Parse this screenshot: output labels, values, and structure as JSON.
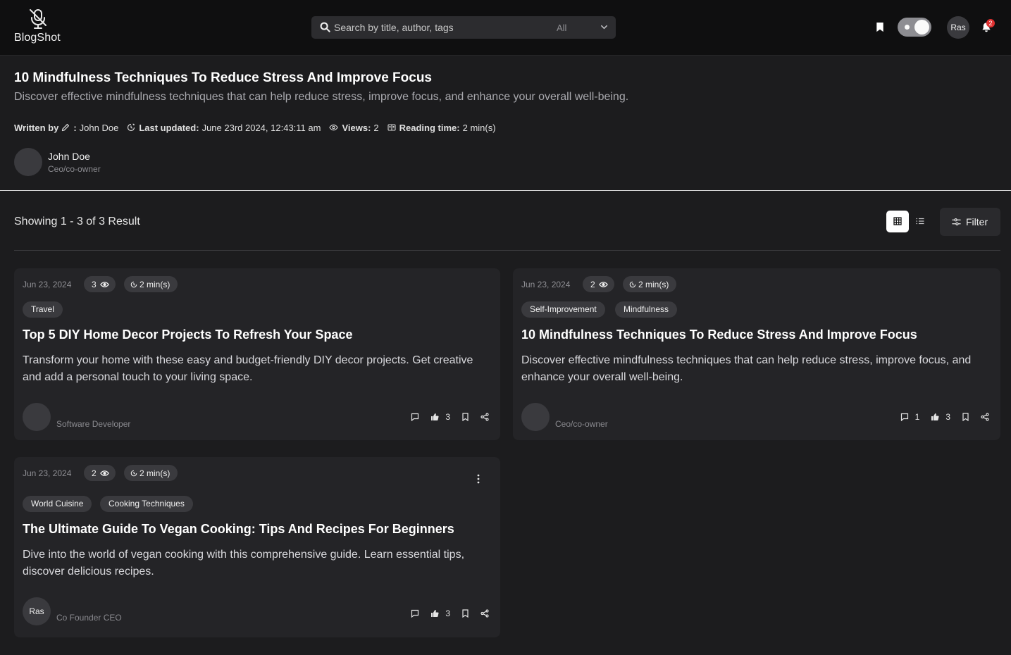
{
  "app": {
    "name": "BlogShot"
  },
  "search": {
    "placeholder": "Search by title, author, tags",
    "scope": "All"
  },
  "nav": {
    "avatar_initials": "Ras",
    "notification_count": "2"
  },
  "article": {
    "title": "10 Mindfulness Techniques To Reduce Stress And Improve Focus",
    "description": "Discover effective mindfulness techniques that can help reduce stress, improve focus, and enhance your overall well-being.",
    "written_by_label": "Written by",
    "author_sep": ":",
    "author": "John Doe",
    "last_updated_label": "Last updated:",
    "last_updated": "June 23rd 2024, 12:43:11 am",
    "views_label": "Views:",
    "views": "2",
    "reading_time_label": "Reading time:",
    "reading_time": "2 min(s)",
    "author_card": {
      "name": "John Doe",
      "role": "Ceo/co-owner"
    }
  },
  "results": {
    "summary": "Showing 1 - 3 of 3 Result",
    "filter_label": "Filter"
  },
  "cards": [
    {
      "date": "Jun 23, 2024",
      "views": "3",
      "reading_time": "2 min(s)",
      "tags": [
        "Travel"
      ],
      "title": "Top 5 DIY Home Decor Projects To Refresh Your Space",
      "excerpt": "Transform your home with these easy and budget-friendly DIY decor projects. Get creative and add a personal touch to your living space.",
      "author_initials": "",
      "author_role": "Software Developer",
      "comments": "",
      "likes": "3"
    },
    {
      "date": "Jun 23, 2024",
      "views": "2",
      "reading_time": "2 min(s)",
      "tags": [
        "Self-Improvement",
        "Mindfulness"
      ],
      "title": "10 Mindfulness Techniques To Reduce Stress And Improve Focus",
      "excerpt": "Discover effective mindfulness techniques that can help reduce stress, improve focus, and enhance your overall well-being.",
      "author_initials": "",
      "author_role": "Ceo/co-owner",
      "comments": "1",
      "likes": "3"
    },
    {
      "date": "Jun 23, 2024",
      "views": "2",
      "reading_time": "2 min(s)",
      "tags": [
        "World Cuisine",
        "Cooking Techniques"
      ],
      "title": "The Ultimate Guide To Vegan Cooking: Tips And Recipes For Beginners",
      "excerpt": "Dive into the world of vegan cooking with this comprehensive guide. Learn essential tips, discover delicious recipes.",
      "author_initials": "Ras",
      "author_role": "Co Founder CEO",
      "comments": "",
      "likes": "3"
    }
  ],
  "icons": {
    "logo": "mic-off-icon",
    "search": "search-icon",
    "chevron": "chevron-down-icon",
    "bookmark": "bookmark-icon",
    "bell": "bell-icon",
    "pencil": "pencil-icon",
    "clock": "clock-icon",
    "eye": "eye-icon",
    "book": "book-icon",
    "grid": "grid-icon",
    "list": "list-icon",
    "filter": "sliders-icon",
    "comment": "comment-icon",
    "like": "thumbs-up-icon",
    "share": "share-icon",
    "more": "more-vertical-icon"
  },
  "colors": {
    "background": "#1c1c1e",
    "topbar": "#0f0f10",
    "card": "#242427",
    "pill": "#3a3a3e",
    "badge": "#e03131"
  }
}
